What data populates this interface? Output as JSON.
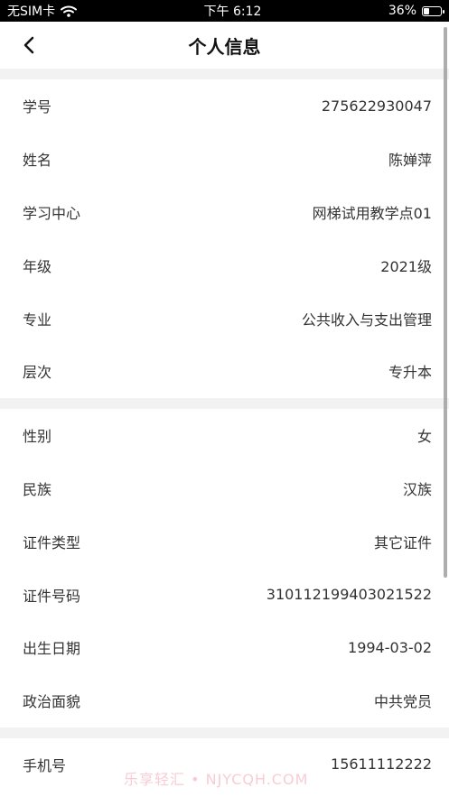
{
  "status_bar": {
    "carrier": "无SIM卡",
    "time": "下午 6:12",
    "battery": "36%",
    "battery_level": 0.36
  },
  "nav": {
    "title": "个人信息"
  },
  "section1": [
    {
      "label": "学号",
      "value": "275622930047"
    },
    {
      "label": "姓名",
      "value": "陈婵萍"
    },
    {
      "label": "学习中心",
      "value": "网梯试用教学点01"
    },
    {
      "label": "年级",
      "value": "2021级"
    },
    {
      "label": "专业",
      "value": "公共收入与支出管理"
    },
    {
      "label": "层次",
      "value": "专升本"
    }
  ],
  "section2": [
    {
      "label": "性别",
      "value": "女"
    },
    {
      "label": "民族",
      "value": "汉族"
    },
    {
      "label": "证件类型",
      "value": "其它证件"
    },
    {
      "label": "证件号码",
      "value": "310112199403021522"
    },
    {
      "label": "出生日期",
      "value": "1994-03-02"
    },
    {
      "label": "政治面貌",
      "value": "中共党员"
    }
  ],
  "section3": [
    {
      "label": "手机号",
      "value": "15611112222"
    }
  ],
  "watermark": "乐享轻汇 • NJYCQH.COM"
}
